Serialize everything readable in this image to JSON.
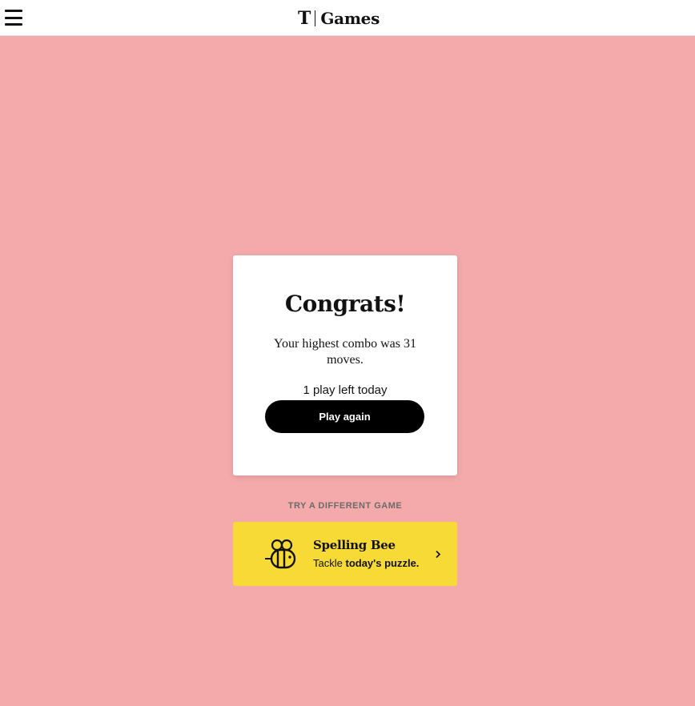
{
  "header": {
    "logo_mark": "T",
    "logo_text": "Games",
    "menu_icon": "hamburger-menu-icon"
  },
  "result_card": {
    "title": "Congrats!",
    "message": "Your highest combo was 31 moves.",
    "plays_left": "1 play left today",
    "play_again_label": "Play again"
  },
  "other_games": {
    "section_label": "TRY A DIFFERENT GAME",
    "game": {
      "icon": "bee-icon",
      "name": "Spelling Bee",
      "subtitle_prefix": "Tackle",
      "subtitle_emphasis": "today's puzzle.",
      "chevron_icon": "chevron-right-icon"
    }
  },
  "colors": {
    "background": "#f4aaaa",
    "game_card": "#f7da35",
    "button": "#000000"
  }
}
